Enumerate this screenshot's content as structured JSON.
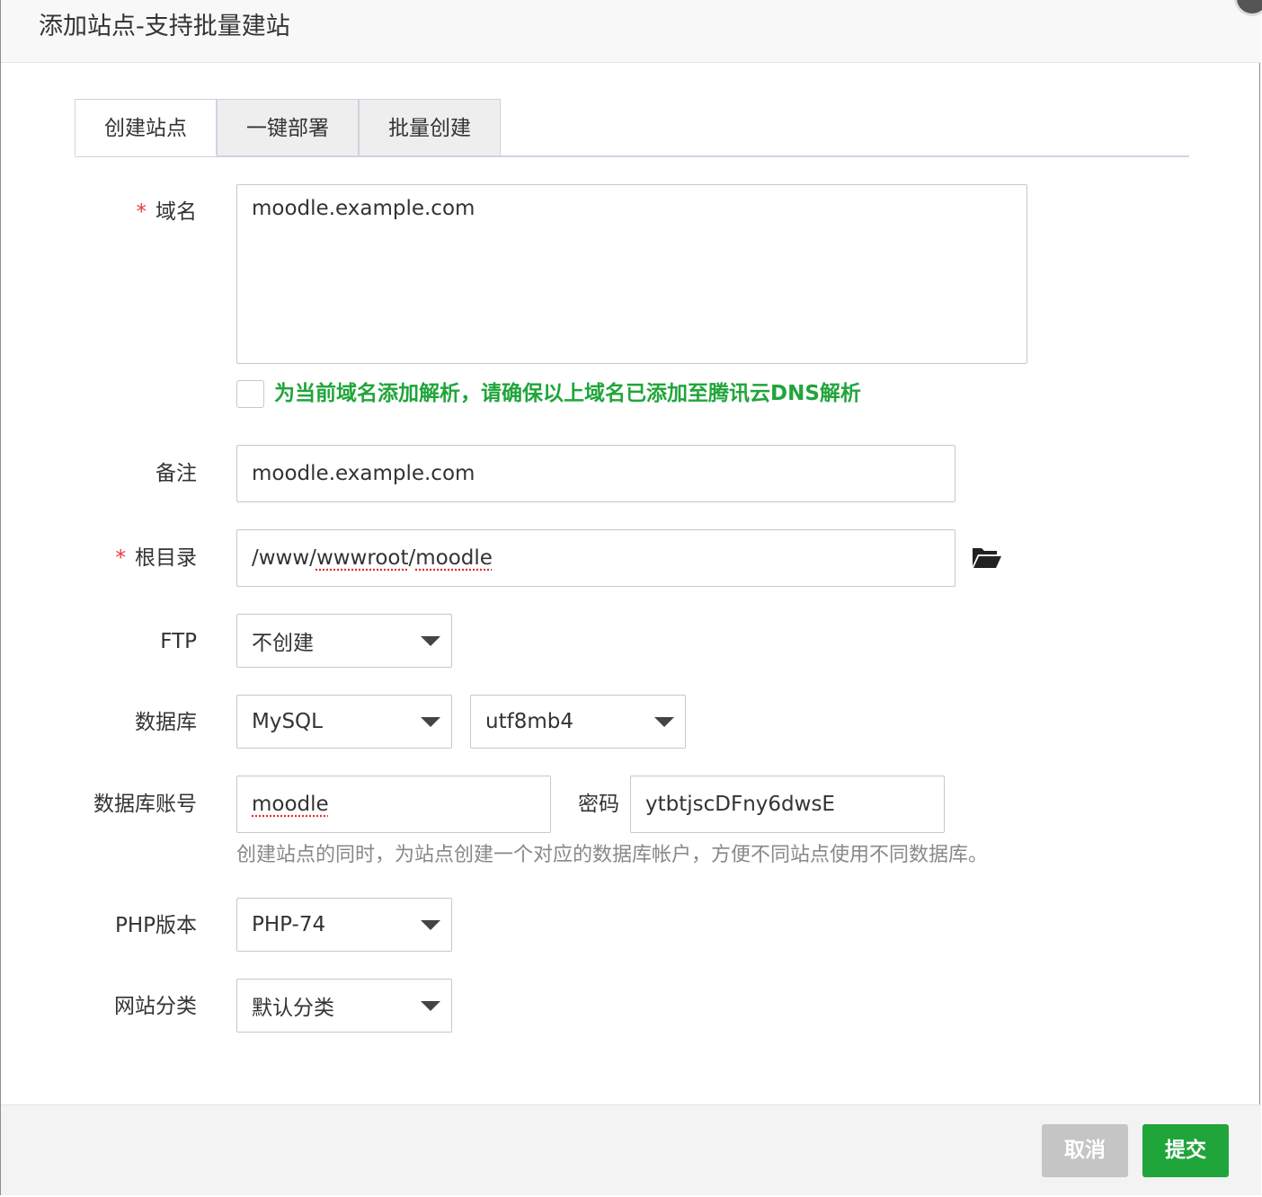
{
  "dialog": {
    "title": "添加站点-支持批量建站"
  },
  "tabs": [
    {
      "label": "创建站点",
      "active": true
    },
    {
      "label": "一键部署",
      "active": false
    },
    {
      "label": "批量创建",
      "active": false
    }
  ],
  "form": {
    "domain": {
      "required_mark": "*",
      "label": "域名",
      "value": "moodle.example.com"
    },
    "dns_checkbox": {
      "checked": false,
      "label": "为当前域名添加解析，请确保以上域名已添加至腾讯云DNS解析"
    },
    "remark": {
      "label": "备注",
      "value": "moodle.example.com"
    },
    "root_dir": {
      "required_mark": "*",
      "label": "根目录",
      "value_prefix": "/www/",
      "value_mid": "wwwroot",
      "value_sep": "/",
      "value_end": "moodle",
      "icon": "folder-open-icon"
    },
    "ftp": {
      "label": "FTP",
      "selected": "不创建"
    },
    "database": {
      "label": "数据库",
      "type_selected": "MySQL",
      "charset_selected": "utf8mb4"
    },
    "db_account": {
      "label": "数据库账号",
      "value": "moodle",
      "password_label": "密码",
      "password_value": "ytbtjscDFny6dwsE",
      "hint": "创建站点的同时，为站点创建一个对应的数据库帐户，方便不同站点使用不同数据库。"
    },
    "php_version": {
      "label": "PHP版本",
      "selected": "PHP-74"
    },
    "site_category": {
      "label": "网站分类",
      "selected": "默认分类"
    }
  },
  "footer": {
    "cancel_label": "取消",
    "submit_label": "提交"
  },
  "colors": {
    "accent": "#20a53a",
    "required": "#e83a3a",
    "cancel": "#c5c5c5"
  }
}
